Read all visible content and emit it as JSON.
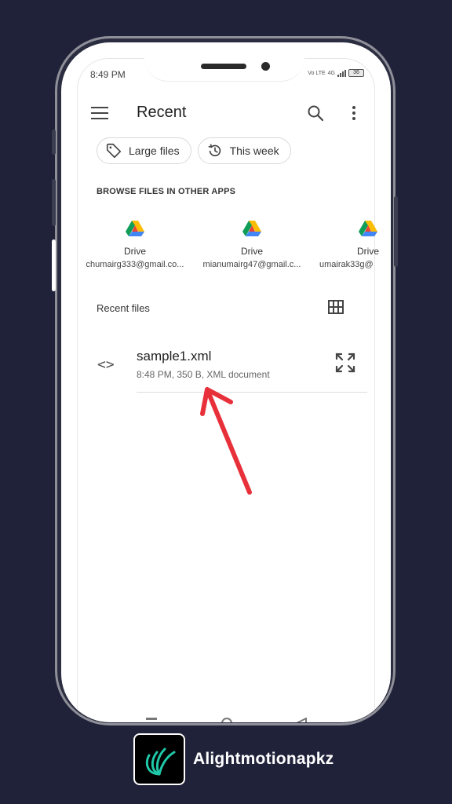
{
  "status_bar": {
    "time": "8:49 PM",
    "network": "Vo LTE",
    "signal": "4G",
    "battery": "36"
  },
  "header": {
    "title": "Recent"
  },
  "filters": [
    {
      "label": "Large files",
      "icon": "tag-icon"
    },
    {
      "label": "This week",
      "icon": "history-icon"
    }
  ],
  "browse": {
    "label": "BROWSE FILES IN OTHER APPS",
    "apps": [
      {
        "name": "Drive",
        "account": "chumairg333@gmail.co...",
        "icon": "google-drive-icon"
      },
      {
        "name": "Drive",
        "account": "mianumairg47@gmail.c...",
        "icon": "google-drive-icon"
      },
      {
        "name": "Drive",
        "account": "umairak33g@",
        "icon": "google-drive-icon"
      }
    ]
  },
  "recent": {
    "label": "Recent files",
    "files": [
      {
        "name": "sample1.xml",
        "meta": "8:48 PM, 350 B, XML document",
        "icon": "code-icon"
      }
    ]
  },
  "annotation": {
    "color": "#e8303a",
    "icon": "red-arrow"
  },
  "brand": {
    "name": "Alightmotionapkz",
    "accent": "#1ec8a8"
  },
  "colors": {
    "background": "#20223a",
    "screen": "#ffffff"
  }
}
